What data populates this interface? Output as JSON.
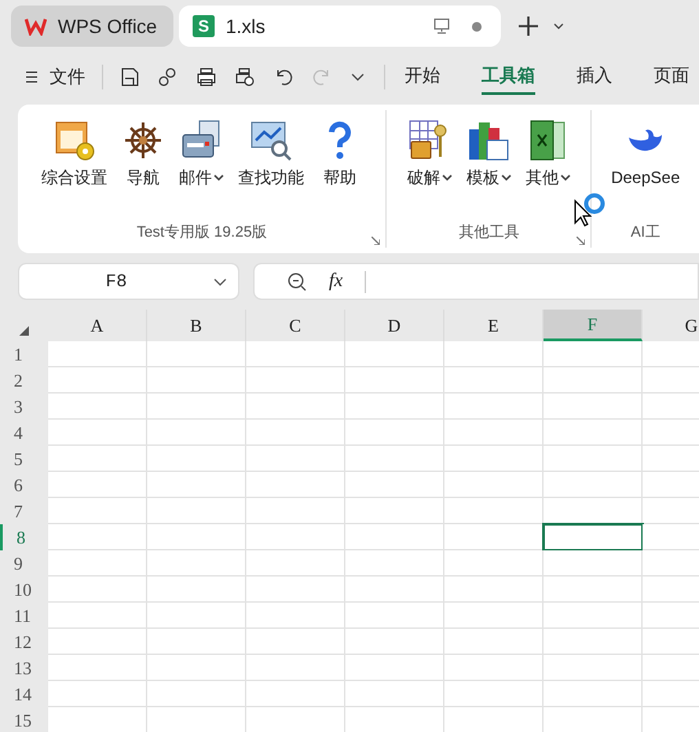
{
  "app_tabs": [
    {
      "kind": "home",
      "label": "WPS Office",
      "selected": false
    },
    {
      "kind": "file",
      "label": "1.xls",
      "badge": "S",
      "selected": true
    }
  ],
  "menu": {
    "file_label": "文件",
    "tabs": [
      {
        "label": "开始",
        "selected": false
      },
      {
        "label": "工具箱",
        "selected": true
      },
      {
        "label": "插入",
        "selected": false
      },
      {
        "label": "页面",
        "selected": false
      }
    ]
  },
  "ribbon": {
    "groups": [
      {
        "title": "Test专用版 19.25版",
        "buttons": [
          {
            "label": "综合设置",
            "kind": "settings",
            "dropdown": false
          },
          {
            "label": "导航",
            "kind": "wheel",
            "dropdown": false
          },
          {
            "label": "邮件",
            "kind": "mail",
            "dropdown": true
          },
          {
            "label": "查找功能",
            "kind": "find",
            "dropdown": false
          },
          {
            "label": "帮助",
            "kind": "help",
            "dropdown": false
          }
        ]
      },
      {
        "title": "其他工具",
        "buttons": [
          {
            "label": "破解",
            "kind": "lock",
            "dropdown": true
          },
          {
            "label": "模板",
            "kind": "books",
            "dropdown": true
          },
          {
            "label": "其他",
            "kind": "fx",
            "dropdown": true
          }
        ]
      },
      {
        "title": "AI工",
        "buttons": [
          {
            "label": "DeepSee",
            "kind": "whale",
            "dropdown": false
          }
        ]
      }
    ]
  },
  "formula_bar": {
    "cell_name": "F8",
    "fx": "fx"
  },
  "sheet": {
    "columns": [
      {
        "label": "A",
        "selected": false
      },
      {
        "label": "B",
        "selected": false
      },
      {
        "label": "C",
        "selected": false
      },
      {
        "label": "D",
        "selected": false
      },
      {
        "label": "E",
        "selected": false
      },
      {
        "label": "F",
        "selected": true
      },
      {
        "label": "G",
        "selected": false
      }
    ],
    "rows": [
      {
        "label": "1",
        "selected": false
      },
      {
        "label": "2",
        "selected": false
      },
      {
        "label": "3",
        "selected": false
      },
      {
        "label": "4",
        "selected": false
      },
      {
        "label": "5",
        "selected": false
      },
      {
        "label": "6",
        "selected": false
      },
      {
        "label": "7",
        "selected": false
      },
      {
        "label": "8",
        "selected": true
      },
      {
        "label": "9",
        "selected": false
      },
      {
        "label": "10",
        "selected": false
      },
      {
        "label": "11",
        "selected": false
      },
      {
        "label": "12",
        "selected": false
      },
      {
        "label": "13",
        "selected": false
      },
      {
        "label": "14",
        "selected": false
      },
      {
        "label": "15",
        "selected": false
      }
    ]
  }
}
